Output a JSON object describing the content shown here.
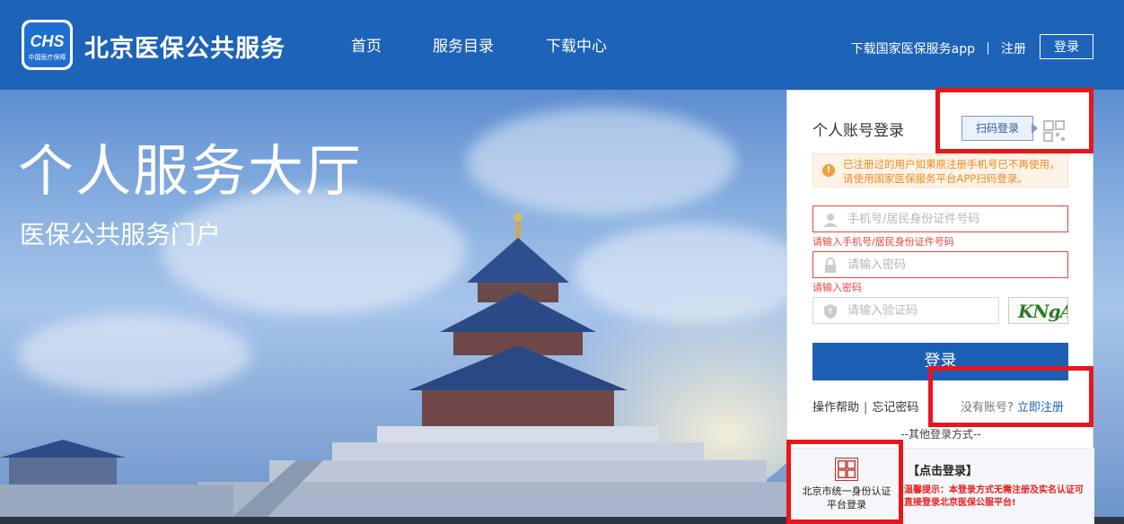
{
  "header": {
    "logo": {
      "badge": "CHS",
      "sub": "中国医疗保障"
    },
    "site_title": "北京医保公共服务",
    "nav": [
      "首页",
      "服务目录",
      "下载中心"
    ],
    "download_app": "下载国家医保服务app",
    "register": "注册",
    "login": "登录"
  },
  "hero": {
    "title": "个人服务大厅",
    "subtitle": "医保公共服务门户"
  },
  "login_panel": {
    "title": "个人账号登录",
    "scan_login": "扫码登录",
    "notice": "已注册过的用户如果原注册手机号已不再使用，请使用国家医保服务平台APP扫码登录。",
    "account_placeholder": "手机号/居民身份证件号码",
    "account_error": "请输入手机号/居民身份证件号码",
    "password_placeholder": "请输入密码",
    "password_error": "请输入密码",
    "captcha_placeholder": "请输入验证码",
    "captcha_text": "KNgA",
    "submit": "登录",
    "help": "操作帮助",
    "forgot": "忘记密码",
    "no_account": "没有账号?",
    "register_now": "立即注册",
    "other_methods": "--其他登录方式--",
    "unified_auth": "北京市统一身份认证平台登录",
    "click_login": "【点击登录】",
    "tip": "温馨提示：本登录方式无需注册及实名认证可直接登录北京医保公服平台!"
  },
  "colors": {
    "header_bg": "#1d63b8",
    "primary_button": "#1d5fb5",
    "error": "#e8453c",
    "annotation": "#e8161c"
  }
}
